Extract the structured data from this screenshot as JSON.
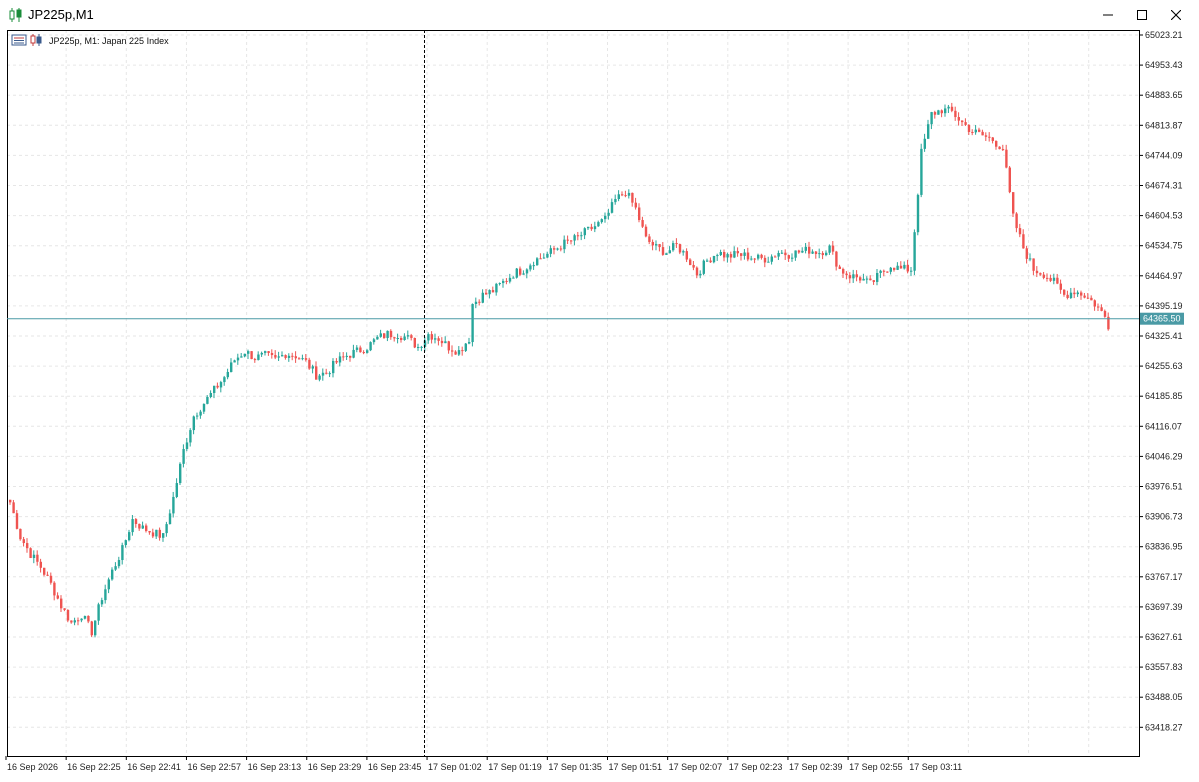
{
  "window": {
    "title": "JP225p,M1",
    "minimize_icon": "minimize-icon",
    "maximize_icon": "maximize-icon",
    "close_icon": "close-icon"
  },
  "chart_header": {
    "text": "JP225p, M1:  Japan 225 Index"
  },
  "colors": {
    "bull": "#26a69a",
    "bear": "#ef5350",
    "price_line": "#4a9aa5",
    "grid": "#e6e6e6"
  },
  "chart_data": {
    "type": "candlestick",
    "symbol": "JP225p",
    "timeframe": "M1",
    "description": "Japan 225 Index",
    "current_price": "64365.50",
    "y_ticks": [
      "65023.21",
      "64953.43",
      "64883.65",
      "64813.87",
      "64744.09",
      "64674.31",
      "64604.53",
      "64534.75",
      "64464.97",
      "64395.19",
      "64325.41",
      "64255.63",
      "64185.85",
      "64116.07",
      "64046.29",
      "63976.51",
      "63906.73",
      "63836.95",
      "63767.17",
      "63697.39",
      "63627.61",
      "63557.83",
      "63488.05",
      "63418.27"
    ],
    "x_ticks": [
      "16 Sep 2026",
      "16 Sep 22:25",
      "16 Sep 22:41",
      "16 Sep 22:57",
      "16 Sep 23:13",
      "16 Sep 23:29",
      "16 Sep 23:45",
      "17 Sep 01:02",
      "17 Sep 01:19",
      "17 Sep 01:35",
      "17 Sep 01:51",
      "17 Sep 02:07",
      "17 Sep 02:23",
      "17 Sep 02:39",
      "17 Sep 02:55",
      "17 Sep 03:11"
    ],
    "ylim": [
      63380,
      65030
    ],
    "session_break_label": "17 Sep 01:02",
    "anchors": [
      [
        0,
        63940
      ],
      [
        3,
        63860
      ],
      [
        6,
        63820
      ],
      [
        9,
        63790
      ],
      [
        12,
        63750
      ],
      [
        15,
        63700
      ],
      [
        18,
        63660
      ],
      [
        21,
        63680
      ],
      [
        24,
        63640
      ],
      [
        27,
        63720
      ],
      [
        30,
        63780
      ],
      [
        33,
        63830
      ],
      [
        36,
        63900
      ],
      [
        39,
        63880
      ],
      [
        42,
        63870
      ],
      [
        45,
        63860
      ],
      [
        48,
        63950
      ],
      [
        51,
        64060
      ],
      [
        54,
        64140
      ],
      [
        57,
        64170
      ],
      [
        60,
        64200
      ],
      [
        63,
        64230
      ],
      [
        66,
        64270
      ],
      [
        69,
        64290
      ],
      [
        72,
        64275
      ],
      [
        75,
        64280
      ],
      [
        78,
        64270
      ],
      [
        81,
        64285
      ],
      [
        84,
        64280
      ],
      [
        87,
        64265
      ],
      [
        90,
        64235
      ],
      [
        93,
        64240
      ],
      [
        96,
        64265
      ],
      [
        99,
        64280
      ],
      [
        102,
        64290
      ],
      [
        105,
        64300
      ],
      [
        108,
        64320
      ],
      [
        111,
        64330
      ],
      [
        114,
        64330
      ],
      [
        117,
        64320
      ],
      [
        120,
        64300
      ],
      [
        123,
        64330
      ],
      [
        126,
        64320
      ],
      [
        129,
        64300
      ],
      [
        132,
        64290
      ],
      [
        135,
        64320
      ],
      [
        136,
        64400
      ],
      [
        139,
        64420
      ],
      [
        142,
        64430
      ],
      [
        145,
        64450
      ],
      [
        148,
        64470
      ],
      [
        151,
        64480
      ],
      [
        154,
        64500
      ],
      [
        157,
        64510
      ],
      [
        160,
        64525
      ],
      [
        163,
        64540
      ],
      [
        166,
        64550
      ],
      [
        169,
        64565
      ],
      [
        172,
        64580
      ],
      [
        175,
        64595
      ],
      [
        178,
        64640
      ],
      [
        181,
        64660
      ],
      [
        184,
        64620
      ],
      [
        187,
        64550
      ],
      [
        190,
        64530
      ],
      [
        193,
        64520
      ],
      [
        196,
        64535
      ],
      [
        199,
        64510
      ],
      [
        202,
        64470
      ],
      [
        205,
        64500
      ],
      [
        208,
        64520
      ],
      [
        211,
        64510
      ],
      [
        214,
        64515
      ],
      [
        217,
        64510
      ],
      [
        220,
        64505
      ],
      [
        223,
        64505
      ],
      [
        226,
        64520
      ],
      [
        229,
        64515
      ],
      [
        232,
        64520
      ],
      [
        235,
        64525
      ],
      [
        238,
        64520
      ],
      [
        241,
        64530
      ],
      [
        244,
        64480
      ],
      [
        247,
        64465
      ],
      [
        250,
        64460
      ],
      [
        253,
        64445
      ],
      [
        256,
        64470
      ],
      [
        259,
        64490
      ],
      [
        262,
        64480
      ],
      [
        265,
        64480
      ],
      [
        268,
        64750
      ],
      [
        271,
        64840
      ],
      [
        274,
        64850
      ],
      [
        277,
        64845
      ],
      [
        280,
        64820
      ],
      [
        283,
        64800
      ],
      [
        286,
        64790
      ],
      [
        289,
        64780
      ],
      [
        292,
        64760
      ],
      [
        295,
        64600
      ],
      [
        298,
        64530
      ],
      [
        301,
        64480
      ],
      [
        304,
        64470
      ],
      [
        307,
        64450
      ],
      [
        310,
        64420
      ],
      [
        313,
        64430
      ],
      [
        316,
        64420
      ],
      [
        319,
        64400
      ],
      [
        322,
        64370
      ],
      [
        323,
        64350
      ]
    ]
  }
}
